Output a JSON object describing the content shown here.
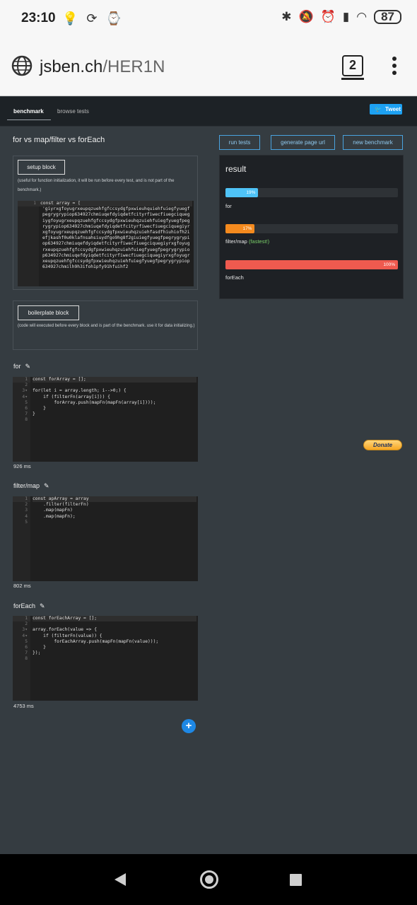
{
  "status_bar": {
    "time": "23:10",
    "battery": "87"
  },
  "browser": {
    "domain": "jsben.ch",
    "path": "/HER1N",
    "tab_count": "2"
  },
  "nav": {
    "tabs": [
      "benchmark",
      "browse tests"
    ],
    "tweet_label": "Tweet"
  },
  "page_title": "for vs map/filter vs forEach",
  "toolbar": {
    "run_tests": "run tests",
    "generate_url": "generate page url",
    "new_benchmark": "new benchmark"
  },
  "setup": {
    "button": "setup block",
    "note": "(useful for function initialization, it will be run before every test, and is not part of the benchmark.)",
    "code": [
      "const array = [",
      "  'giyrxgfoyugrxeupqzuehfgfccsydgfpxwieuhquiehfuiegfyuegfpegrygrypiop634927chmiuqefdyiqdetfcityrfiwecfiuegciquegiygfoyugrxeupqzuehfgfccsydgfpxwieuhqzuiehfuiegfyuegfpegrygrypiop634927chmiuqefdyiqdetfcityrfiwecfiuegciquegiyrxgfoyugrxeupqzuehfgfccsydgfpxwieuhqzuiehfasdfhiuhiofh2iefjkashf0u0klafnsahsiuydfgo9hg8f2giuiegfyuegfpegrygrypiop634927chmiuqefdyiqdetfcityrfiwecfiuegciquegiyrxgfoyugrxeupqzuehfgfccsydgfpxwieuhqzuiehfuiegfyuegfpegrygrypiop634927chmiuqefdyiqdetfcityrfiwecfiuegciquegiyrxgfoyugrxeupqzuehfgfccsydgfpxwieuhqzuiehfuiegfyuegfpegrygrypiop634927chmilh9h3ifoh1pfy91hfuihf2"
    ]
  },
  "boilerplate": {
    "button": "boilerplate block",
    "note": "(code will executed before every block and is part of the benchmark. use it for data initializing.)"
  },
  "tests": [
    {
      "name": "for",
      "time": "926 ms",
      "code": [
        "const forArray = [];",
        "",
        "for(let i = array.length; i-->0;) {",
        "    if (filterFn(array[i])) {",
        "        forArray.push(mapFn(mapFn(array[i])));",
        "    }",
        "}",
        ""
      ]
    },
    {
      "name": "filter/map",
      "time": "802 ms",
      "code": [
        "const apArray = array",
        "    .filter(filterFn)",
        "    .map(mapFn)",
        "    .map(mapFn);",
        ""
      ]
    },
    {
      "name": "forEach",
      "time": "4753 ms",
      "code": [
        "const forEachArray = [];",
        "",
        "array.forEach(value => {",
        "    if (filterFn(value)) {",
        "        forEachArray.push(mapFn(mapFn(value)));",
        "    }",
        "});",
        ""
      ]
    }
  ],
  "result": {
    "title": "result",
    "fastest_label": "(fastest!)",
    "items": [
      {
        "name": "for",
        "percent_text": "19%",
        "percent": 19,
        "color": "#4fc3f7"
      },
      {
        "name": "filter/map",
        "percent_text": "17%",
        "percent": 17,
        "color": "#f48a1e"
      },
      {
        "name": "forEach",
        "percent_text": "100%",
        "percent": 100,
        "color": "#ef5a4f"
      }
    ]
  },
  "donate_label": "Donate",
  "colors": {
    "accent": "#1e88e5",
    "background": "#353c41",
    "panel": "#1e2125"
  },
  "icons": [
    "globe-icon",
    "pencil-icon",
    "plus-icon",
    "twitter-bird-icon",
    "bluetooth-icon",
    "wifi-icon",
    "signal-icon",
    "alarm-icon"
  ]
}
